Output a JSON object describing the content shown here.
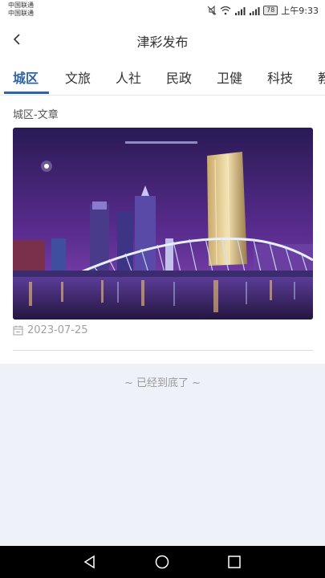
{
  "status_bar": {
    "carrier_1": "中国联通",
    "carrier_2": "中国联通",
    "battery": "78",
    "time": "上午9:33"
  },
  "header": {
    "title": "津彩发布"
  },
  "tabs": [
    {
      "label": "城区",
      "active": true
    },
    {
      "label": "文旅"
    },
    {
      "label": "人社"
    },
    {
      "label": "民政"
    },
    {
      "label": "卫健"
    },
    {
      "label": "科技"
    },
    {
      "label": "教"
    }
  ],
  "article": {
    "section_label": "城区-文章",
    "date": "2023-07-25"
  },
  "footer": {
    "end_text": "~ 已经到底了 ~"
  },
  "colors": {
    "accent": "#2e63a5",
    "page_background": "#eef1f7"
  },
  "icons": [
    "back-arrow-icon",
    "calendar-icon",
    "android-back-icon",
    "android-home-icon",
    "android-recents-icon"
  ]
}
